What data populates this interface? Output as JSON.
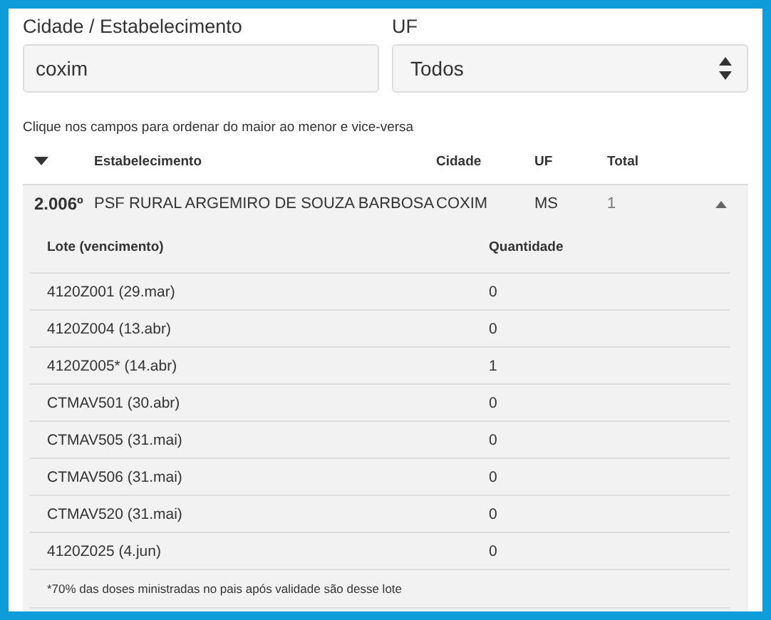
{
  "filters": {
    "city_label": "Cidade / Estabelecimento",
    "city_value": "coxim",
    "uf_label": "UF",
    "uf_value": "Todos"
  },
  "hint": "Clique nos campos para ordenar do maior ao menor e vice-versa",
  "table": {
    "columns": [
      "Estabelecimento",
      "Cidade",
      "UF",
      "Total"
    ],
    "rows": [
      {
        "rank": "2.006º",
        "establishment": "PSF RURAL ARGEMIRO DE SOUZA BARBOSA",
        "city": "COXIM",
        "uf": "MS",
        "total": "1",
        "expanded": true,
        "detail": {
          "columns": [
            "Lote (vencimento)",
            "Quantidade"
          ],
          "rows": [
            [
              "4120Z001 (29.mar)",
              "0"
            ],
            [
              "4120Z004 (13.abr)",
              "0"
            ],
            [
              "4120Z005* (14.abr)",
              "1"
            ],
            [
              "CTMAV501 (30.abr)",
              "0"
            ],
            [
              "CTMAV505 (31.mai)",
              "0"
            ],
            [
              "CTMAV506 (31.mai)",
              "0"
            ],
            [
              "CTMAV520 (31.mai)",
              "0"
            ],
            [
              "4120Z025 (4.jun)",
              "0"
            ]
          ],
          "footnote": "*70% das doses ministradas no pais após validade são desse lote"
        }
      }
    ]
  }
}
